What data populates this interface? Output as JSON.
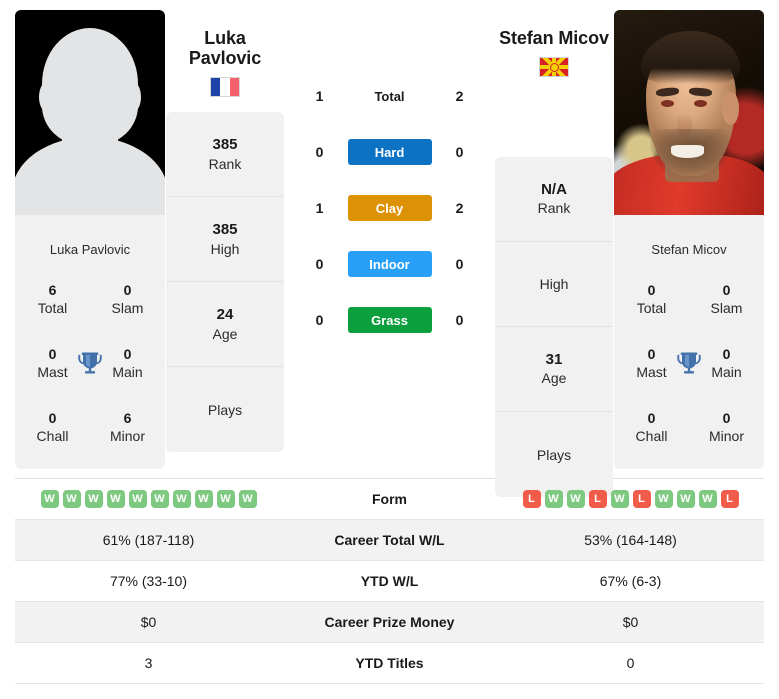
{
  "players": {
    "left": {
      "name_line1": "Luka",
      "name_line2": "Pavlovic",
      "full_name": "Luka Pavlovic",
      "caption": "Luka Pavlovic",
      "flag": "france-flag",
      "photo": "silhouette-avatar",
      "info": [
        {
          "value": "385",
          "label": "Rank"
        },
        {
          "value": "385",
          "label": "High"
        },
        {
          "value": "24",
          "label": "Age"
        },
        {
          "value": "",
          "label": "Plays"
        }
      ],
      "titles": [
        {
          "value": "6",
          "label": "Total"
        },
        {
          "value": "0",
          "label": "Slam"
        },
        {
          "value": "0",
          "label": "Mast"
        },
        {
          "value": "0",
          "label": "Main"
        },
        {
          "value": "0",
          "label": "Chall"
        },
        {
          "value": "6",
          "label": "Minor"
        }
      ],
      "form": [
        "W",
        "W",
        "W",
        "W",
        "W",
        "W",
        "W",
        "W",
        "W",
        "W"
      ],
      "career_total_wl": "61% (187-118)",
      "ytd_wl": "77% (33-10)",
      "career_prize_money": "$0",
      "ytd_titles": "3"
    },
    "right": {
      "name_line1": "Stefan Micov",
      "name_line2": "",
      "full_name": "Stefan Micov",
      "caption": "Stefan Micov",
      "flag": "north-macedonia-flag",
      "photo": "player-portrait",
      "info": [
        {
          "value": "N/A",
          "label": "Rank"
        },
        {
          "value": "",
          "label": "High"
        },
        {
          "value": "31",
          "label": "Age"
        },
        {
          "value": "",
          "label": "Plays"
        }
      ],
      "titles": [
        {
          "value": "0",
          "label": "Total"
        },
        {
          "value": "0",
          "label": "Slam"
        },
        {
          "value": "0",
          "label": "Mast"
        },
        {
          "value": "0",
          "label": "Main"
        },
        {
          "value": "0",
          "label": "Chall"
        },
        {
          "value": "0",
          "label": "Minor"
        }
      ],
      "form": [
        "L",
        "W",
        "W",
        "L",
        "W",
        "L",
        "W",
        "W",
        "W",
        "L"
      ],
      "career_total_wl": "53% (164-148)",
      "ytd_wl": "67% (6-3)",
      "career_prize_money": "$0",
      "ytd_titles": "0"
    }
  },
  "head_to_head": [
    {
      "label": "Total",
      "left": "1",
      "right": "2",
      "type": "plain",
      "color": ""
    },
    {
      "label": "Hard",
      "left": "0",
      "right": "0",
      "type": "badge",
      "color": "#0c72c4"
    },
    {
      "label": "Clay",
      "left": "1",
      "right": "2",
      "type": "badge",
      "color": "#dd9205"
    },
    {
      "label": "Indoor",
      "left": "0",
      "right": "0",
      "type": "badge",
      "color": "#29a0f7"
    },
    {
      "label": "Grass",
      "left": "0",
      "right": "0",
      "type": "badge",
      "color": "#0d9e3e"
    }
  ],
  "stats_rows": [
    {
      "label": "Form",
      "left": "",
      "right": "",
      "type": "form"
    },
    {
      "label": "Career Total W/L",
      "left": "61% (187-118)",
      "right": "53% (164-148)",
      "type": "text"
    },
    {
      "label": "YTD W/L",
      "left": "77% (33-10)",
      "right": "67% (6-3)",
      "type": "text"
    },
    {
      "label": "Career Prize Money",
      "left": "$0",
      "right": "$0",
      "type": "text"
    },
    {
      "label": "YTD Titles",
      "left": "3",
      "right": "0",
      "type": "text"
    }
  ],
  "colors": {
    "hard": "#0c72c4",
    "clay": "#dd9205",
    "indoor": "#29a0f7",
    "grass": "#0d9e3e",
    "win": "#7dc97f",
    "loss": "#f15b4a",
    "trophy": "#4371ab",
    "card_bg": "#f1f1f1"
  }
}
